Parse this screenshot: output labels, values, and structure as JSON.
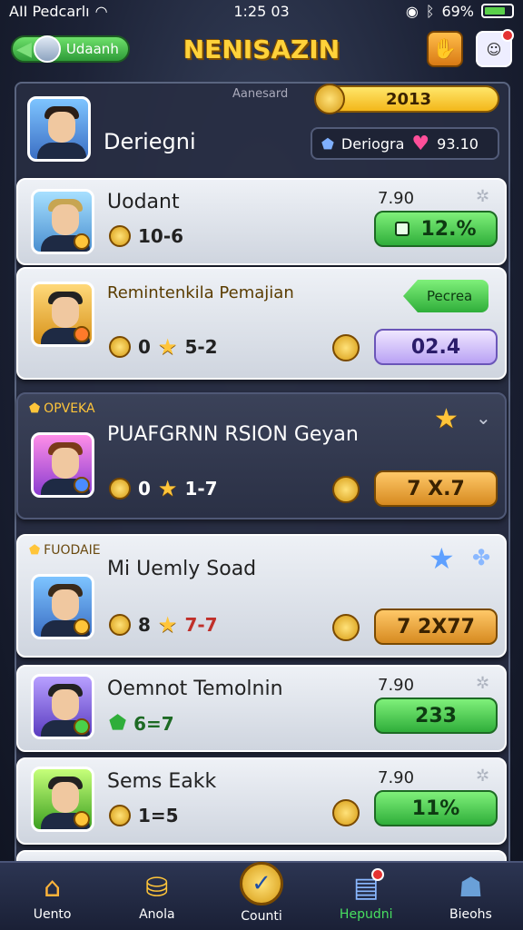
{
  "status": {
    "carrier": "AII Pedcarlı",
    "time": "1:25 03",
    "battery": "69%"
  },
  "header": {
    "back_label": "Udaanh",
    "title": "NENISAZIN"
  },
  "profile_card": {
    "subtitle": "Aanesard",
    "name": "Deriegni",
    "gold_value": "2013",
    "stat_label": "Deriogra",
    "stat_value": "93.10"
  },
  "cards": [
    {
      "name": "Uodant",
      "stat": "10-6",
      "value": "7.90",
      "pill": "12.%"
    },
    {
      "name": "Remintenkila Pemajian",
      "stat_a": "0",
      "stat_b": "5-2",
      "arrow_label": "Pecrea",
      "pill": "02.4"
    },
    {
      "tag": "OPVEKA",
      "name": "PUAFGRNN RSION Geyan",
      "stat_a": "0",
      "stat_b": "1-7",
      "pill": "7 X.7"
    },
    {
      "tag": "FUODAIE",
      "name": "Mi Uemly Soad",
      "stat_a": "8",
      "stat_b": "7-7",
      "pill": "7 2X77"
    },
    {
      "name": "Oemnot Temolnin",
      "stat": "6=7",
      "value": "7.90",
      "pill": "233"
    },
    {
      "name": "Sems Eakk",
      "stat": "1=5",
      "value": "7.90",
      "pill": "11%"
    }
  ],
  "nav": [
    {
      "label": "Uento",
      "icon": "home-icon"
    },
    {
      "label": "Anola",
      "icon": "bucket-icon"
    },
    {
      "label": "Counti",
      "icon": "check-icon"
    },
    {
      "label": "Hepudni",
      "icon": "inbox-icon"
    },
    {
      "label": "Bieohs",
      "icon": "people-icon"
    }
  ]
}
